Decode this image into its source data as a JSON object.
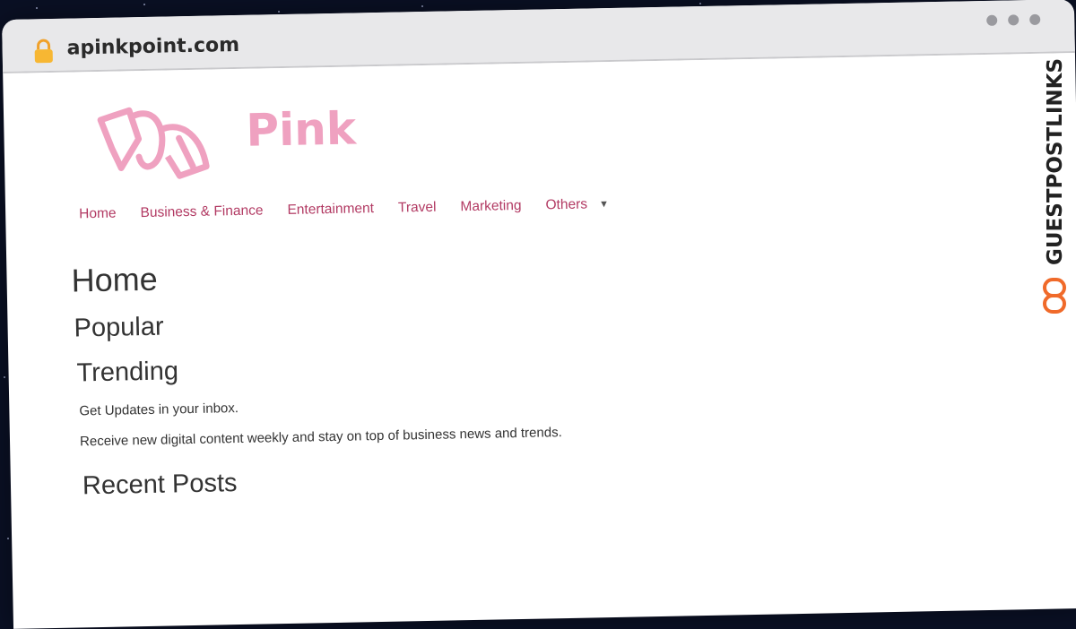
{
  "browser": {
    "url": "apinkpoint.com",
    "lock_icon": "lock-icon",
    "window_dots": [
      "dot",
      "dot",
      "dot"
    ]
  },
  "site": {
    "brand": "Pink",
    "brand_color": "#efa1c0",
    "nav": [
      "Home",
      "Business & Finance",
      "Entertainment",
      "Travel",
      "Marketing",
      "Others"
    ],
    "nav_color": "#b23a63"
  },
  "content": {
    "page_title": "Home",
    "popular": "Popular",
    "trending": "Trending",
    "updates_title": "Get Updates in your inbox.",
    "updates_desc": "Receive new digital content weekly and stay on top of business news and trends.",
    "recent_posts": "Recent Posts"
  },
  "watermark": {
    "text": "GUESTPOSTLINKS",
    "accent": "#f06a2a"
  }
}
